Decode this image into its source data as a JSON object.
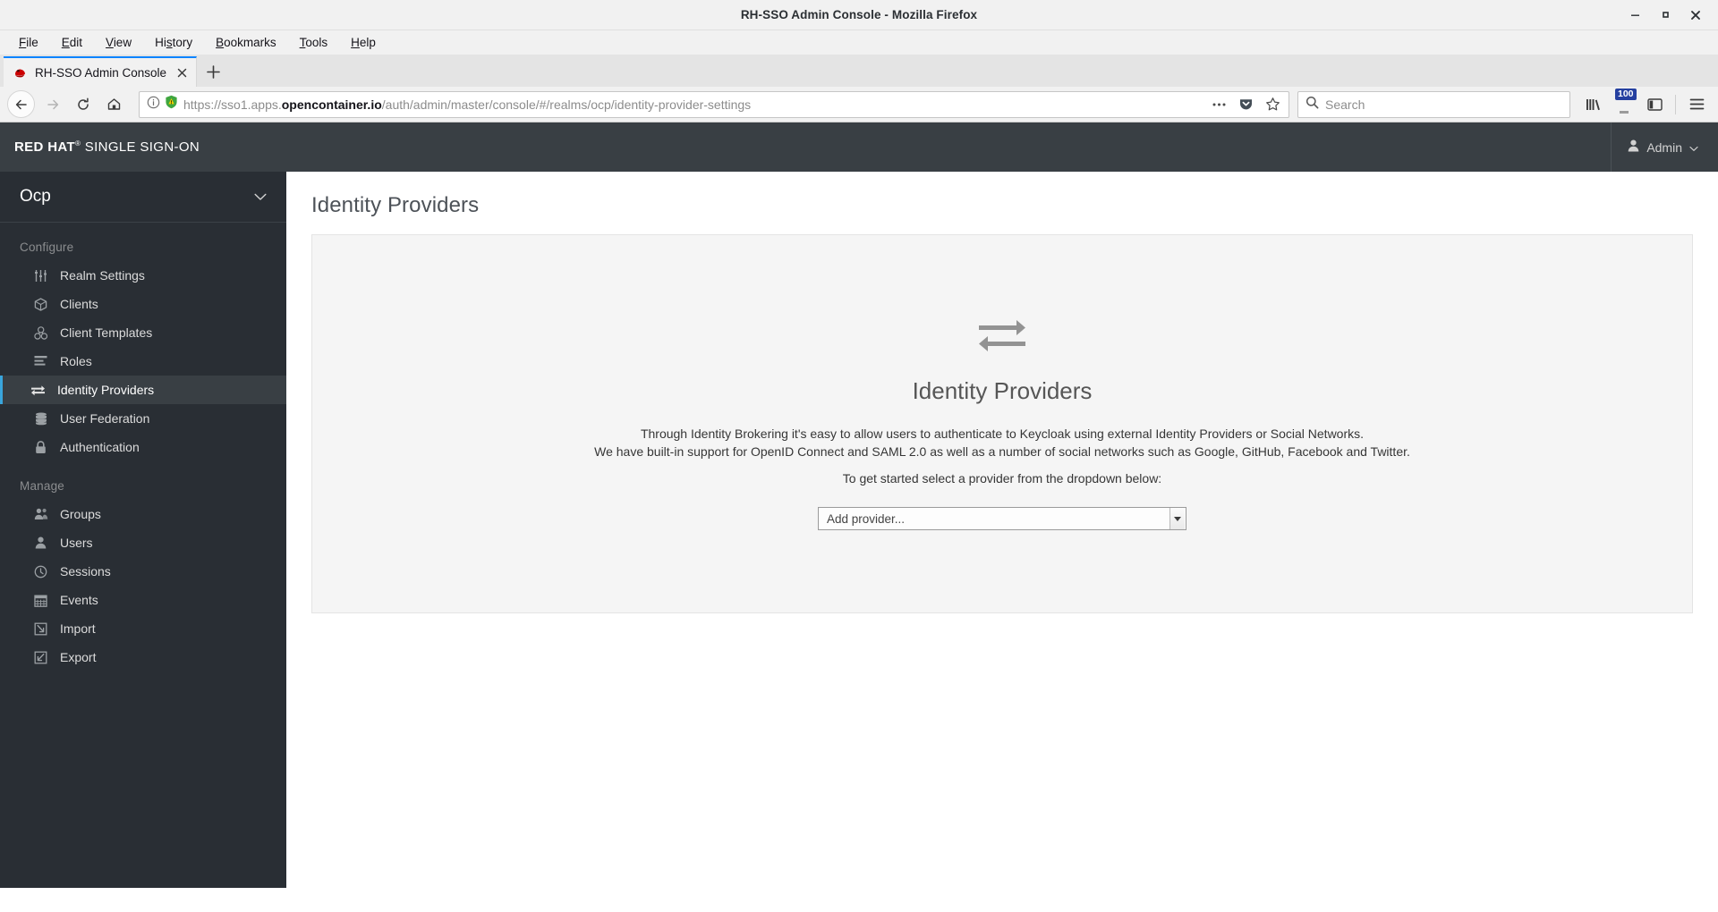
{
  "window": {
    "title": "RH-SSO Admin Console - Mozilla Firefox",
    "minimize": "–",
    "maximize": "▫",
    "close": "✕"
  },
  "menubar": [
    {
      "label": "File",
      "accel": "F"
    },
    {
      "label": "Edit",
      "accel": "E"
    },
    {
      "label": "View",
      "accel": "V"
    },
    {
      "label": "History",
      "accel": "s"
    },
    {
      "label": "Bookmarks",
      "accel": "B"
    },
    {
      "label": "Tools",
      "accel": "T"
    },
    {
      "label": "Help",
      "accel": "H"
    }
  ],
  "tabs": {
    "active": {
      "title": "RH-SSO Admin Console",
      "favicon": "redhat-fedora-icon",
      "close": "✕"
    },
    "newtab_label": "+"
  },
  "navbar": {
    "back": "back-arrow-icon",
    "forward": "forward-arrow-icon",
    "reload": "reload-icon",
    "home": "home-icon",
    "url": {
      "scheme": "https://",
      "subdomain": "sso1.apps.",
      "domain": "opencontainer.io",
      "path": "/auth/admin/master/console/#/realms/ocp/identity-provider-settings",
      "info_icon": "info-circle-icon",
      "shield_icon": "shield-warning-icon",
      "page_actions_icon": "ellipsis-icon",
      "pocket_icon": "pocket-icon",
      "bookmark_icon": "star-outline-icon"
    },
    "search": {
      "placeholder": "Search",
      "icon": "magnifier-icon"
    },
    "library_icon": "library-icon",
    "library_badge": "100",
    "sidebar_icon": "sidebar-panel-icon",
    "menu_icon": "hamburger-menu-icon"
  },
  "app_header": {
    "brand_bold": "RED HAT",
    "brand_tm": "®",
    "brand_light": "SINGLE SIGN-ON",
    "user_label": "Admin",
    "user_icon": "user-icon",
    "chevron": "chevron-down-icon"
  },
  "sidebar": {
    "realm": {
      "name": "Ocp",
      "chevron": "chevron-down-icon"
    },
    "sections": [
      {
        "title": "Configure",
        "items": [
          {
            "label": "Realm Settings",
            "icon": "sliders-icon",
            "active": false
          },
          {
            "label": "Clients",
            "icon": "cube-icon",
            "active": false
          },
          {
            "label": "Client Templates",
            "icon": "cubes-icon",
            "active": false
          },
          {
            "label": "Roles",
            "icon": "list-lines-icon",
            "active": false
          },
          {
            "label": "Identity Providers",
            "icon": "exchange-arrows-icon",
            "active": true
          },
          {
            "label": "User Federation",
            "icon": "database-icon",
            "active": false
          },
          {
            "label": "Authentication",
            "icon": "lock-icon",
            "active": false
          }
        ]
      },
      {
        "title": "Manage",
        "items": [
          {
            "label": "Groups",
            "icon": "users-group-icon",
            "active": false
          },
          {
            "label": "Users",
            "icon": "user-icon",
            "active": false
          },
          {
            "label": "Sessions",
            "icon": "clock-icon",
            "active": false
          },
          {
            "label": "Events",
            "icon": "calendar-icon",
            "active": false
          },
          {
            "label": "Import",
            "icon": "import-arrow-icon",
            "active": false
          },
          {
            "label": "Export",
            "icon": "export-arrow-icon",
            "active": false
          }
        ]
      }
    ]
  },
  "main": {
    "page_title": "Identity Providers",
    "empty_state": {
      "icon": "exchange-arrows-icon",
      "heading": "Identity Providers",
      "line1": "Through Identity Brokering it's easy to allow users to authenticate to Keycloak using external Identity Providers or Social Networks.",
      "line2": "We have built-in support for OpenID Connect and SAML 2.0 as well as a number of social networks such as Google, GitHub, Facebook and Twitter.",
      "line3": "To get started select a provider from the dropdown below:",
      "select_value": "Add provider..."
    }
  },
  "colors": {
    "brand_dark": "#393f44",
    "sidebar_bg": "#292e34",
    "active_accent": "#39a5dc",
    "panel_bg": "#f5f5f5",
    "tab_accent": "#0a84ff",
    "badge_bg": "#2540a0"
  }
}
